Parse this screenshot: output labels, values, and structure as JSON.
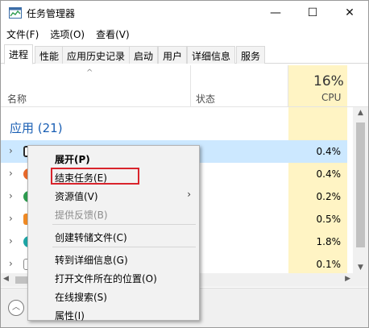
{
  "window": {
    "title": "任务管理器",
    "icon": "task-manager-icon",
    "controls": {
      "minimize": "—",
      "maximize": "☐",
      "close": "✕"
    }
  },
  "menu": [
    "文件(F)",
    "选项(O)",
    "查看(V)"
  ],
  "tabs": [
    {
      "label": "进程",
      "active": true
    },
    {
      "label": "性能",
      "active": false
    },
    {
      "label": "应用历史记录",
      "active": false
    },
    {
      "label": "启动",
      "active": false
    },
    {
      "label": "用户",
      "active": false
    },
    {
      "label": "详细信息",
      "active": false
    },
    {
      "label": "服务",
      "active": false
    }
  ],
  "columns": {
    "sort_indicator": "^",
    "name": "名称",
    "status": "状态",
    "cpu_percent": "16%",
    "cpu": "CPU"
  },
  "group": {
    "label": "应用 (21)"
  },
  "rows": [
    {
      "cpu": "0.4%",
      "selected": true,
      "icon": "app-window-icon",
      "icon_color": "#2b2b2b"
    },
    {
      "cpu": "0.4%",
      "selected": false,
      "icon": "firefox-icon",
      "icon_color": "#e8692b"
    },
    {
      "cpu": "0.2%",
      "selected": false,
      "icon": "chrome-icon",
      "icon_color": "#2e9c4f"
    },
    {
      "cpu": "0.5%",
      "selected": false,
      "icon": "orange-app-icon",
      "icon_color": "#f08a24"
    },
    {
      "cpu": "1.8%",
      "selected": false,
      "icon": "teal-app-icon",
      "icon_color": "#1ea6a6"
    },
    {
      "cpu": "0.1%",
      "selected": false,
      "icon": "document-app-icon",
      "icon_color": "#8a8a8a"
    }
  ],
  "colors": {
    "cpu_column": "#fff4c4",
    "selection": "#cce8ff",
    "group_title": "#1a5fb4",
    "highlight": "#d9242c"
  },
  "context_menu": {
    "items": [
      {
        "label": "展开(P)",
        "bold": true,
        "disabled": false,
        "submenu": false
      },
      {
        "label": "结束任务(E)",
        "bold": false,
        "disabled": false,
        "submenu": false,
        "highlighted": true
      },
      {
        "label": "资源值(V)",
        "bold": false,
        "disabled": false,
        "submenu": true
      },
      {
        "label": "提供反馈(B)",
        "bold": false,
        "disabled": true,
        "submenu": false
      },
      {
        "label": "创建转储文件(C)",
        "bold": false,
        "disabled": false,
        "submenu": false
      },
      {
        "label": "转到详细信息(G)",
        "bold": false,
        "disabled": false,
        "submenu": false
      },
      {
        "label": "打开文件所在的位置(O)",
        "bold": false,
        "disabled": false,
        "submenu": false
      },
      {
        "label": "在线搜索(S)",
        "bold": false,
        "disabled": false,
        "submenu": false
      },
      {
        "label": "属性(I)",
        "bold": false,
        "disabled": false,
        "submenu": false
      }
    ],
    "submenu_arrow": "›"
  }
}
